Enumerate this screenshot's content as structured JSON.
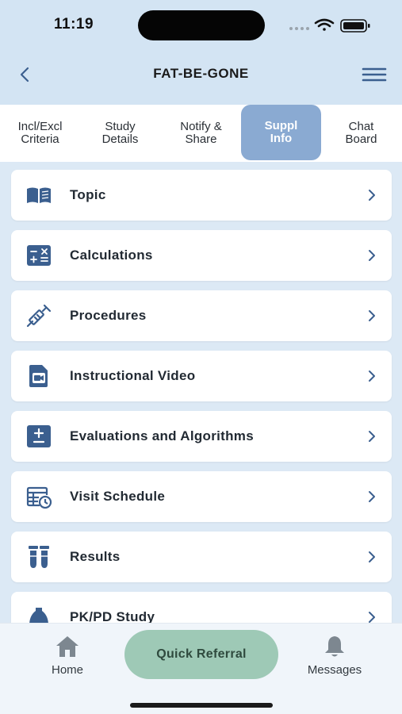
{
  "status_bar": {
    "time": "11:19"
  },
  "header": {
    "title": "FAT-BE-GONE"
  },
  "tabs": [
    {
      "label": "Incl/Excl\nCriteria",
      "active": false
    },
    {
      "label": "Study\nDetails",
      "active": false
    },
    {
      "label": "Notify &\nShare",
      "active": false
    },
    {
      "label": "Suppl\nInfo",
      "active": true
    },
    {
      "label": "Chat\nBoard",
      "active": false
    }
  ],
  "items": [
    {
      "label": "Topic",
      "icon": "book-icon"
    },
    {
      "label": "Calculations",
      "icon": "calculator-icon"
    },
    {
      "label": "Procedures",
      "icon": "syringe-icon"
    },
    {
      "label": "Instructional Video",
      "icon": "video-file-icon"
    },
    {
      "label": "Evaluations and Algorithms",
      "icon": "plus-minus-icon"
    },
    {
      "label": "Visit Schedule",
      "icon": "schedule-icon"
    },
    {
      "label": "Results",
      "icon": "test-tubes-icon"
    },
    {
      "label": "PK/PD Study",
      "icon": "flask-icon"
    }
  ],
  "bottom_nav": {
    "home_label": "Home",
    "quick_referral_label": "Quick Referral",
    "messages_label": "Messages"
  },
  "colors": {
    "accent_tab": "#8aaad2",
    "icon_blue": "#3b5f8f",
    "quick_referral": "#9ec9b6",
    "background": "#dce9f5"
  }
}
